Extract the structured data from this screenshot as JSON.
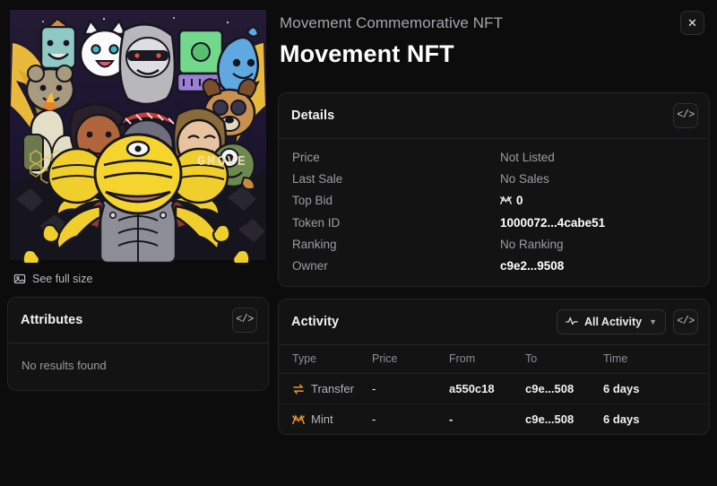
{
  "header": {
    "collection_name": "Movement Commemorative NFT",
    "nft_title": "Movement NFT",
    "close_label": "✕"
  },
  "artwork": {
    "alt": "Movement Commemorative NFT artwork",
    "watermark": "GMOVE",
    "see_full_size_label": "See full size"
  },
  "attributes": {
    "title": "Attributes",
    "code_label": "</>",
    "empty_text": "No results found"
  },
  "details": {
    "title": "Details",
    "code_label": "</>",
    "rows": [
      {
        "label": "Price",
        "value": "Not Listed",
        "style": "muted"
      },
      {
        "label": "Last Sale",
        "value": "No Sales",
        "style": "muted"
      },
      {
        "label": "Top Bid",
        "value": "0",
        "style": "strong",
        "token_glyph": true
      },
      {
        "label": "Token ID",
        "value": "1000072...4cabe51",
        "style": "strong"
      },
      {
        "label": "Ranking",
        "value": "No Ranking",
        "style": "muted"
      },
      {
        "label": "Owner",
        "value": "c9e2...9508",
        "style": "strong"
      }
    ]
  },
  "activity": {
    "title": "Activity",
    "filter_label": "All Activity",
    "code_label": "</>",
    "columns": [
      "Type",
      "Price",
      "From",
      "To",
      "Time"
    ],
    "rows": [
      {
        "icon": "transfer-icon",
        "type": "Transfer",
        "price": "-",
        "from": "a550c18",
        "to": "c9e...508",
        "time": "6 days"
      },
      {
        "icon": "mint-icon",
        "type": "Mint",
        "price": "-",
        "from": "-",
        "to": "c9e...508",
        "time": "6 days"
      }
    ]
  },
  "colors": {
    "background": "#0c0c0d",
    "panel": "#131314",
    "border": "#242426",
    "accent_orange": "#e8962c",
    "text_primary": "#ffffff",
    "text_muted": "#9d9da1"
  }
}
